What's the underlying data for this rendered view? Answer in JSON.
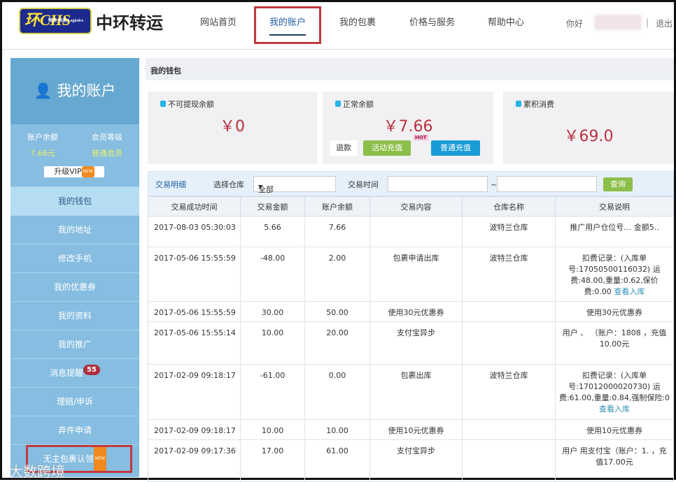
{
  "header": {
    "logo_text": "CHS",
    "logo_sub": "物流·快递 Logistics",
    "brand": "中环转运",
    "nav": [
      "网站首页",
      "我的账户",
      "我的包裹",
      "价格与服务",
      "帮助中心"
    ],
    "greeting": "你好",
    "logout": "退出"
  },
  "sidebar": {
    "title": "我的账户",
    "balance_label": "账户余额",
    "balance": "7.66元",
    "level_label": "会员等级",
    "level": "普通会员",
    "upgrade": "升级VIP",
    "new_tag": "NEW",
    "items": [
      {
        "label": "我的钱包"
      },
      {
        "label": "我的地址"
      },
      {
        "label": "修改手机"
      },
      {
        "label": "我的优惠券"
      },
      {
        "label": "我的资料"
      },
      {
        "label": "我的推广"
      },
      {
        "label": "消息提醒",
        "badge": "55"
      },
      {
        "label": "理赔/申诉"
      },
      {
        "label": "弃件申请"
      },
      {
        "label": "无主包裹认领"
      }
    ]
  },
  "wallet": {
    "title": "我的钱包",
    "cards": [
      {
        "label": "不可提现余额",
        "amount": "￥0"
      },
      {
        "label": "正常余额",
        "amount": "￥7.66"
      },
      {
        "label": "累积消费",
        "amount": "￥69.0"
      }
    ],
    "refund": "退款",
    "promo_recharge": "活动充值",
    "hot": "HOT",
    "normal_recharge": "普通充值"
  },
  "filter": {
    "title": "交易明细",
    "warehouse_label": "选择仓库",
    "warehouse_value": "全部",
    "time_label": "交易时间",
    "tilde": "~",
    "search": "查询"
  },
  "table": {
    "headers": [
      "交易成功时间",
      "交易金额",
      "账户余额",
      "交易内容",
      "仓库名称",
      "交易说明"
    ],
    "rows": [
      [
        "2017-08-03 05:30:03",
        "5.66",
        "7.66",
        "",
        "波特兰仓库",
        "推广用户仓位号… 金额5.."
      ],
      [
        "2017-05-06 15:55:59",
        "-48.00",
        "2.00",
        "包裹申请出库",
        "波特兰仓库",
        "扣费记录：(入库单号:17050500116032) 运费:48.00,重量:0.62,保价费:0.00"
      ],
      [
        "2017-05-06 15:55:59",
        "30.00",
        "50.00",
        "使用30元优惠券",
        "",
        "使用30元优惠券"
      ],
      [
        "2017-05-06 15:55:14",
        "10.00",
        "20.00",
        "支付宝异步",
        "",
        "用户 、 （账户：1808 ，充值10.00元"
      ],
      [
        "2017-02-09 09:18:17",
        "-61.00",
        "0.00",
        "包裹出库",
        "波特兰仓库",
        "扣费记录：(入库单号:17012000020730) 运费:61.00,重量:0.84,强制保险:0"
      ],
      [
        "2017-02-09 09:18:17",
        "10.00",
        "10.00",
        "使用10元优惠券",
        "",
        "使用10元优惠券"
      ],
      [
        "2017-02-09 09:17:36",
        "17.00",
        "61.00",
        "支付宝异步",
        "",
        "用户 用支付宝（账户：1. ，充值17.00元"
      ]
    ],
    "links": [
      "",
      "查看入库",
      "",
      "",
      "查看入库",
      "",
      ""
    ]
  },
  "watermark": "大数跨境"
}
